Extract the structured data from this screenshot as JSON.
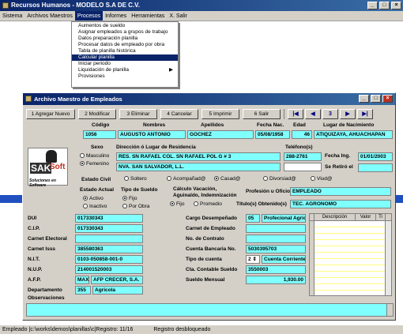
{
  "app": {
    "title": "Recursos Humanos - MODELO S.A DE C.V.",
    "menu": [
      "Sistema",
      "Archivos Maestros",
      "Procesos",
      "Informes",
      "Herramientas",
      "X. Salir"
    ]
  },
  "dropdown": {
    "items": [
      "Aumentos de sueldo",
      "Asignar empleados a grupos de trabajo",
      "Datos preparación planilla",
      "Procesar datos de empleado por obra",
      "Tabla de planilla histórica",
      "Calcular planilla",
      "Iniciar periodo",
      "Liquidación de planilla",
      "Provisiones"
    ],
    "highlighted": "Calcular planilla"
  },
  "window": {
    "title": "Archivo Maestro de Empleados",
    "toolbar": [
      "1 Agregar Nuevo",
      "2 Modificar",
      "3 Eliminar",
      "4 Cancelar",
      "5 Imprimir",
      "6 Salir"
    ],
    "nav": [
      "|◀",
      "◀",
      "3",
      "▶",
      "▶|"
    ]
  },
  "employee": {
    "labels": {
      "codigo": "Código",
      "nombres": "Nombres",
      "apellidos": "Apellidos",
      "fecha_nac": "Fecha Nac.",
      "edad": "Edad",
      "lugar_nac": "Lugar de Nacimiento",
      "sexo": "Sexo",
      "direccion": "Dirección ó Lugar de Residencia",
      "telefonos": "Teléfono(s)",
      "fecha_ing": "Fecha Ing.",
      "se_retiro": "Se Retiró el",
      "estado_civil": "Estado Civil",
      "estado_actual": "Estado Actual",
      "tipo_sueldo": "Tipo de Sueldo",
      "calculo": "Cálculo Vacación, Aguinaldo, Indemnización",
      "profesion": "Profesión u Oficio",
      "titulos": "Título(s) Obtenido(s)",
      "dui": "DUI",
      "cip": "C.I.P.",
      "carnet_electoral": "Carnet Electoral",
      "carnet_isss": "Carnet Isss",
      "nit": "N.I.T.",
      "nup": "N.U.P.",
      "afp": "A.F.P.",
      "departamento": "Departamento",
      "cargo": "Cargo Desempeñado",
      "carnet_empleado": "Carnet de Empleado",
      "no_contrato": "No. de Contrato",
      "cuenta_bancaria": "Cuenta Bancaria No.",
      "tipo_cuenta": "Tipo de cuenta",
      "cta_contable": "Cta. Contable Sueldo",
      "sueldo": "Sueldo Mensual",
      "observaciones": "Observaciones"
    },
    "values": {
      "codigo": "1056",
      "nombres": "AUGUSTO ANTONIO",
      "apellidos": "GOCHEZ",
      "fecha_nac": "05/08/1958",
      "edad": "46",
      "lugar_nac": "ATIQUIZAYA, AHUACHAPAN",
      "direccion1": "RES. SN RAFAEL COL. SN RAFAEL POL G # 3",
      "direccion2": "NVA. SAN SALVADOR, L.L.",
      "telefono": "288-2761",
      "fecha_ing": "01/01/2003",
      "se_retiro": "",
      "profesion": "EMPLEADO",
      "titulos": "TEC. AGRONOMO",
      "dui": "017330343",
      "cip": "017330343",
      "carnet_electoral": "",
      "carnet_isss": "385580363",
      "nit": "0103-050858-001-0",
      "nup": "214001520003",
      "afp_code": "MAX",
      "afp_name": "AFP CRECER, S.A.",
      "dep_code": "355",
      "dep_name": "Agricola",
      "cargo_code": "05",
      "cargo_name": "Profecional Agricola",
      "carnet_empleado": "",
      "no_contrato": "",
      "cuenta_bancaria": "5030395703",
      "tipo_cuenta_code": "2",
      "tipo_cuenta_name": "Cuenta Corriente",
      "cta_contable": "3550003",
      "sueldo": "1,930.00"
    },
    "sexo": [
      "Masculino",
      "Femenino"
    ],
    "estado_civil": [
      "Soltero",
      "Acompañad@",
      "Casad@",
      "Divorsiad@",
      "Viud@"
    ],
    "estado_actual": [
      "Activo",
      "Inactivo"
    ],
    "tipo_sueldo": [
      "Fijo",
      "Por Obra"
    ],
    "calculo": [
      "Fijo",
      "Promedio"
    ],
    "grid_headers": [
      "Descripción",
      "Valor",
      "Ti"
    ]
  },
  "status": {
    "path": "Empleado |c:\\works\\demos\\planillas\\c|Registro: 11/16",
    "state": "Registro desbloqueado"
  }
}
